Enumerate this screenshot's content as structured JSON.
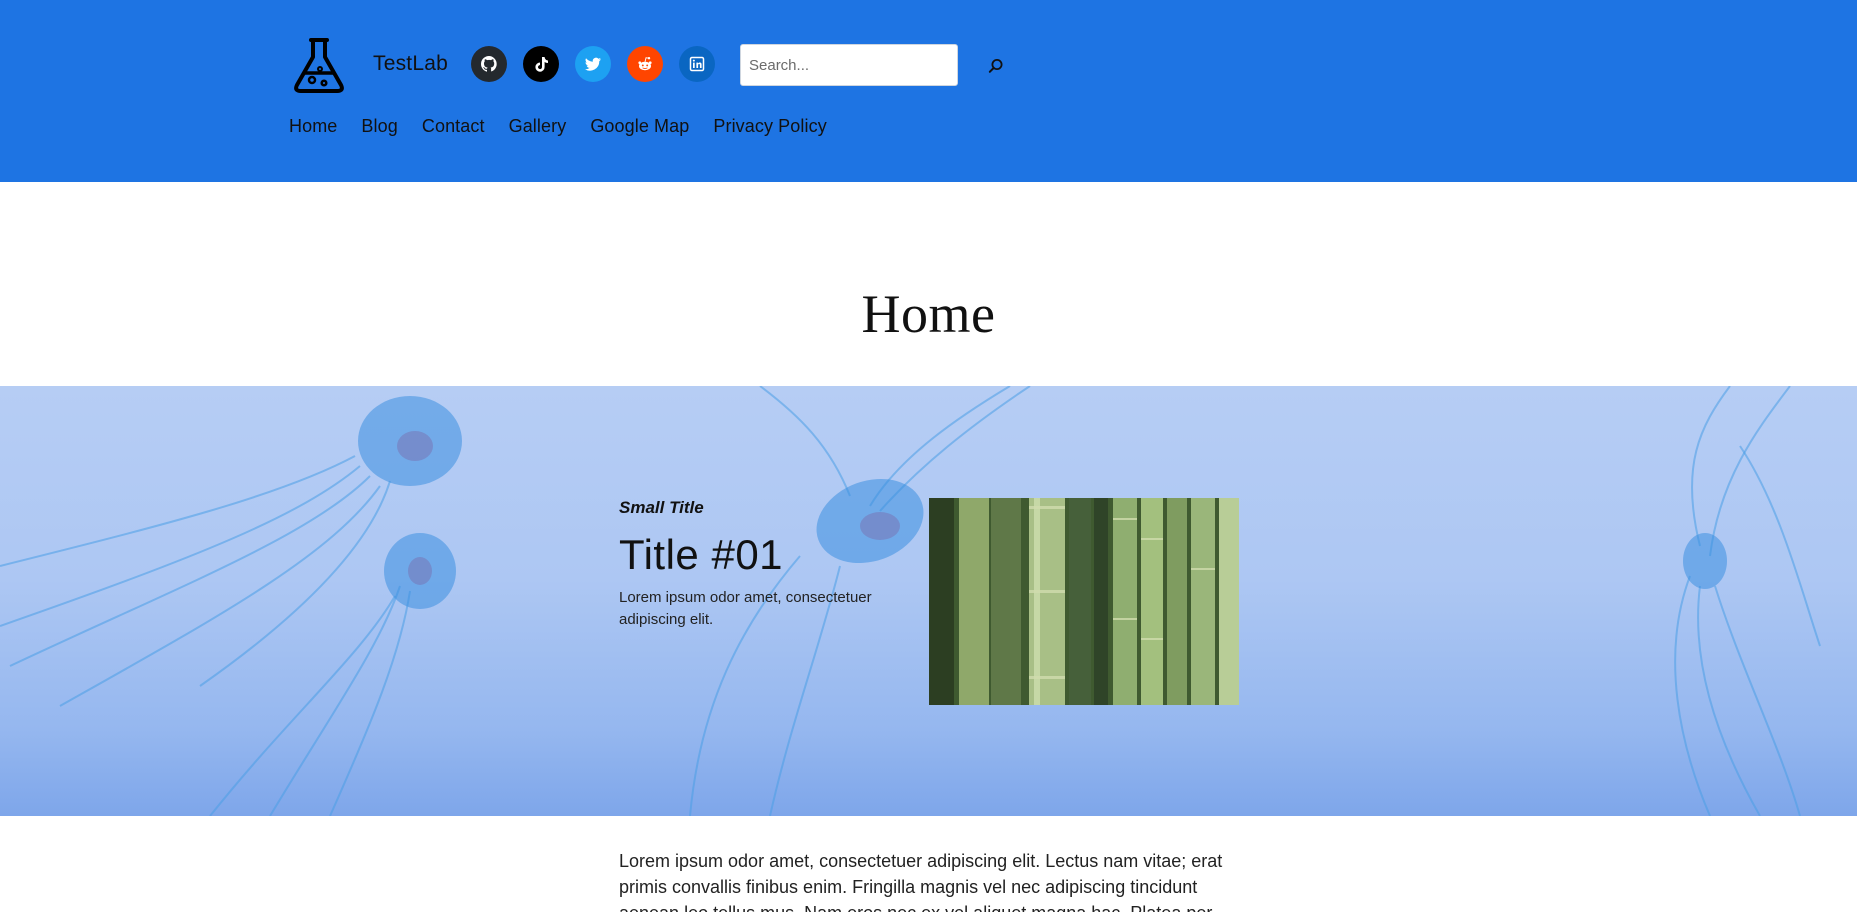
{
  "header": {
    "site_title": "TestLab",
    "search_placeholder": "Search...",
    "socials": [
      {
        "name": "github",
        "bg": "#24292e"
      },
      {
        "name": "tiktok",
        "bg": "#000000"
      },
      {
        "name": "twitter",
        "bg": "#1da1f2"
      },
      {
        "name": "reddit",
        "bg": "#ff4500"
      },
      {
        "name": "linkedin",
        "bg": "#0a66c2"
      }
    ],
    "nav": [
      "Home",
      "Blog",
      "Contact",
      "Gallery",
      "Google Map",
      "Privacy Policy"
    ]
  },
  "page": {
    "title": "Home"
  },
  "hero": {
    "small_title": "Small Title",
    "title": "Title #01",
    "text": "Lorem ipsum odor amet, consectetuer adipiscing elit."
  },
  "body": {
    "paragraph": "Lorem ipsum odor amet, consectetuer adipiscing elit. Lectus nam vitae; erat primis convallis finibus enim. Fringilla magnis vel nec adipiscing tincidunt aenean leo tellus mus. Nam eros nec ex vel aliquet magna hac. Platea per"
  },
  "colors": {
    "header_bg": "#1e74e3",
    "hero_bg": "#adc7f3"
  }
}
